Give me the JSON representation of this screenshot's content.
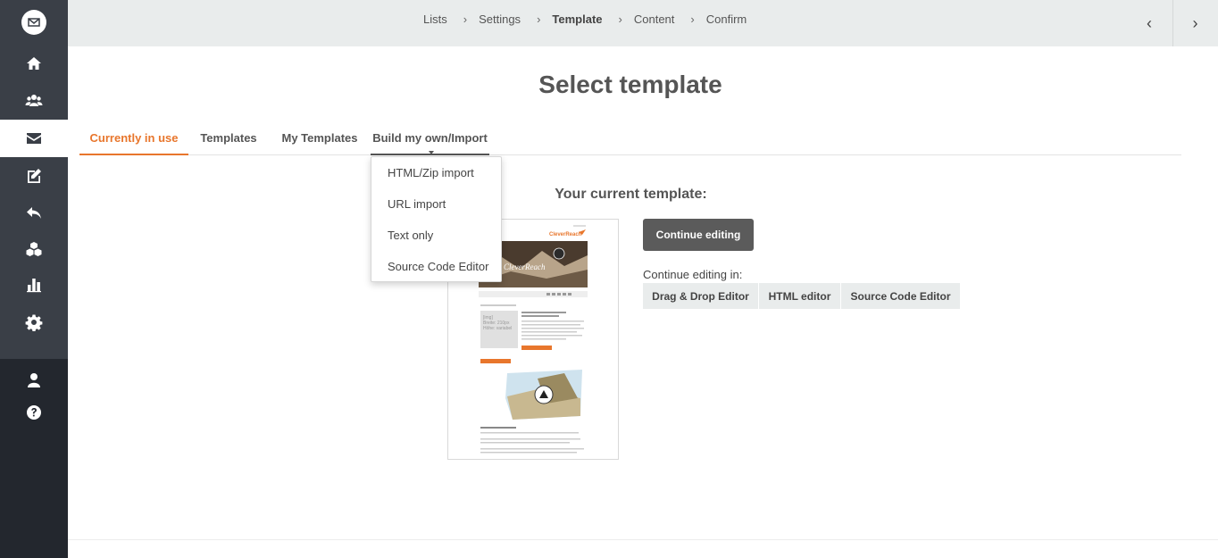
{
  "sidebar": {
    "items": [
      {
        "icon": "home-icon"
      },
      {
        "icon": "users-icon"
      },
      {
        "icon": "envelope-icon"
      },
      {
        "icon": "edit-icon"
      },
      {
        "icon": "reply-icon"
      },
      {
        "icon": "cubes-icon"
      },
      {
        "icon": "bar-chart-icon"
      },
      {
        "icon": "gear-icon"
      }
    ],
    "bottom": [
      {
        "icon": "user-icon"
      },
      {
        "icon": "help-icon"
      }
    ]
  },
  "breadcrumb": {
    "steps": [
      "Lists",
      "Settings",
      "Template",
      "Content",
      "Confirm"
    ],
    "current": "Template"
  },
  "page": {
    "title": "Select template"
  },
  "tabs": {
    "currently_in_use": "Currently in use",
    "templates": "Templates",
    "my_templates": "My Templates",
    "build_own": "Build my own/Import"
  },
  "dropdown": {
    "items": [
      "HTML/Zip import",
      "URL import",
      "Text only",
      "Source Code Editor"
    ]
  },
  "current": {
    "heading": "Your current template:",
    "continue_button": "Continue editing",
    "continue_in_label": "Continue editing in:",
    "editors": [
      "Drag & Drop Editor",
      "HTML editor",
      "Source Code Editor"
    ]
  },
  "preview": {
    "brand": "CleverReach",
    "placeholder_line1": "[img]",
    "placeholder_line2": "Breite: 210px",
    "placeholder_line3": "Höhe: variabel"
  },
  "colors": {
    "accent": "#e8762c",
    "sidebar_dark": "#23272e",
    "sidebar": "#3a3f47"
  }
}
